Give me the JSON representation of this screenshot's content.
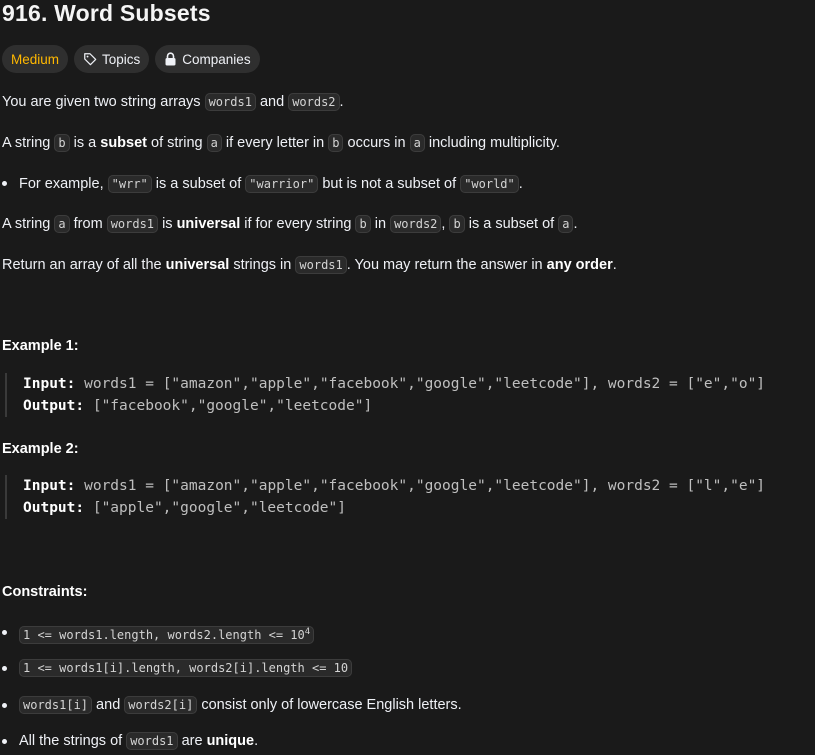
{
  "problem": {
    "title": "916. Word Subsets",
    "tags": {
      "difficulty": "Medium",
      "topics": "Topics",
      "companies": "Companies"
    },
    "icons": {
      "topics": "tag-icon",
      "companies": "lock-icon"
    },
    "colors": {
      "difficulty": "#ffb800",
      "background": "#1a1a1a"
    }
  },
  "desc": {
    "p1": {
      "t1": "You are given two string arrays ",
      "c1": "words1",
      "t2": " and ",
      "c2": "words2",
      "t3": "."
    },
    "p2": {
      "t1": "A string ",
      "c1": "b",
      "t2": " is a ",
      "b1": "subset",
      "t3": " of string ",
      "c2": "a",
      "t4": " if every letter in ",
      "c3": "b",
      "t5": " occurs in ",
      "c4": "a",
      "t6": " including multiplicity."
    },
    "bullet": {
      "t1": "For example, ",
      "c1": "\"wrr\"",
      "t2": " is a subset of ",
      "c2": "\"warrior\"",
      "t3": " but is not a subset of ",
      "c3": "\"world\"",
      "t4": "."
    },
    "p3": {
      "t1": "A string ",
      "c1": "a",
      "t2": " from ",
      "c2": "words1",
      "t3": " is ",
      "b1": "universal",
      "t4": " if for every string ",
      "c3": "b",
      "t5": " in ",
      "c4": "words2",
      "t6": ", ",
      "c5": "b",
      "t7": " is a subset of ",
      "c6": "a",
      "t8": "."
    },
    "p4": {
      "t1": "Return an array of all the ",
      "b1": "universal",
      "t2": " strings in ",
      "c1": "words1",
      "t3": ". You may return the answer in ",
      "b2": "any order",
      "t4": "."
    }
  },
  "examples": [
    {
      "title": "Example 1:",
      "input_label": "Input:",
      "input": " words1 = [\"amazon\",\"apple\",\"facebook\",\"google\",\"leetcode\"], words2 = [\"e\",\"o\"]",
      "output_label": "Output:",
      "output": " [\"facebook\",\"google\",\"leetcode\"]"
    },
    {
      "title": "Example 2:",
      "input_label": "Input:",
      "input": " words1 = [\"amazon\",\"apple\",\"facebook\",\"google\",\"leetcode\"], words2 = [\"l\",\"e\"]",
      "output_label": "Output:",
      "output": " [\"apple\",\"google\",\"leetcode\"]"
    }
  ],
  "constraints": {
    "title": "Constraints:",
    "c1": {
      "code": "1 <= words1.length, words2.length <= 10",
      "sup": "4"
    },
    "c2": {
      "code": "1 <= words1[i].length, words2[i].length <= 10"
    },
    "c3": {
      "c1": "words1[i]",
      "t1": " and ",
      "c2": "words2[i]",
      "t2": " consist only of lowercase English letters."
    },
    "c4": {
      "t1": "All the strings of ",
      "c1": "words1",
      "t2": " are ",
      "b1": "unique",
      "t3": "."
    }
  }
}
